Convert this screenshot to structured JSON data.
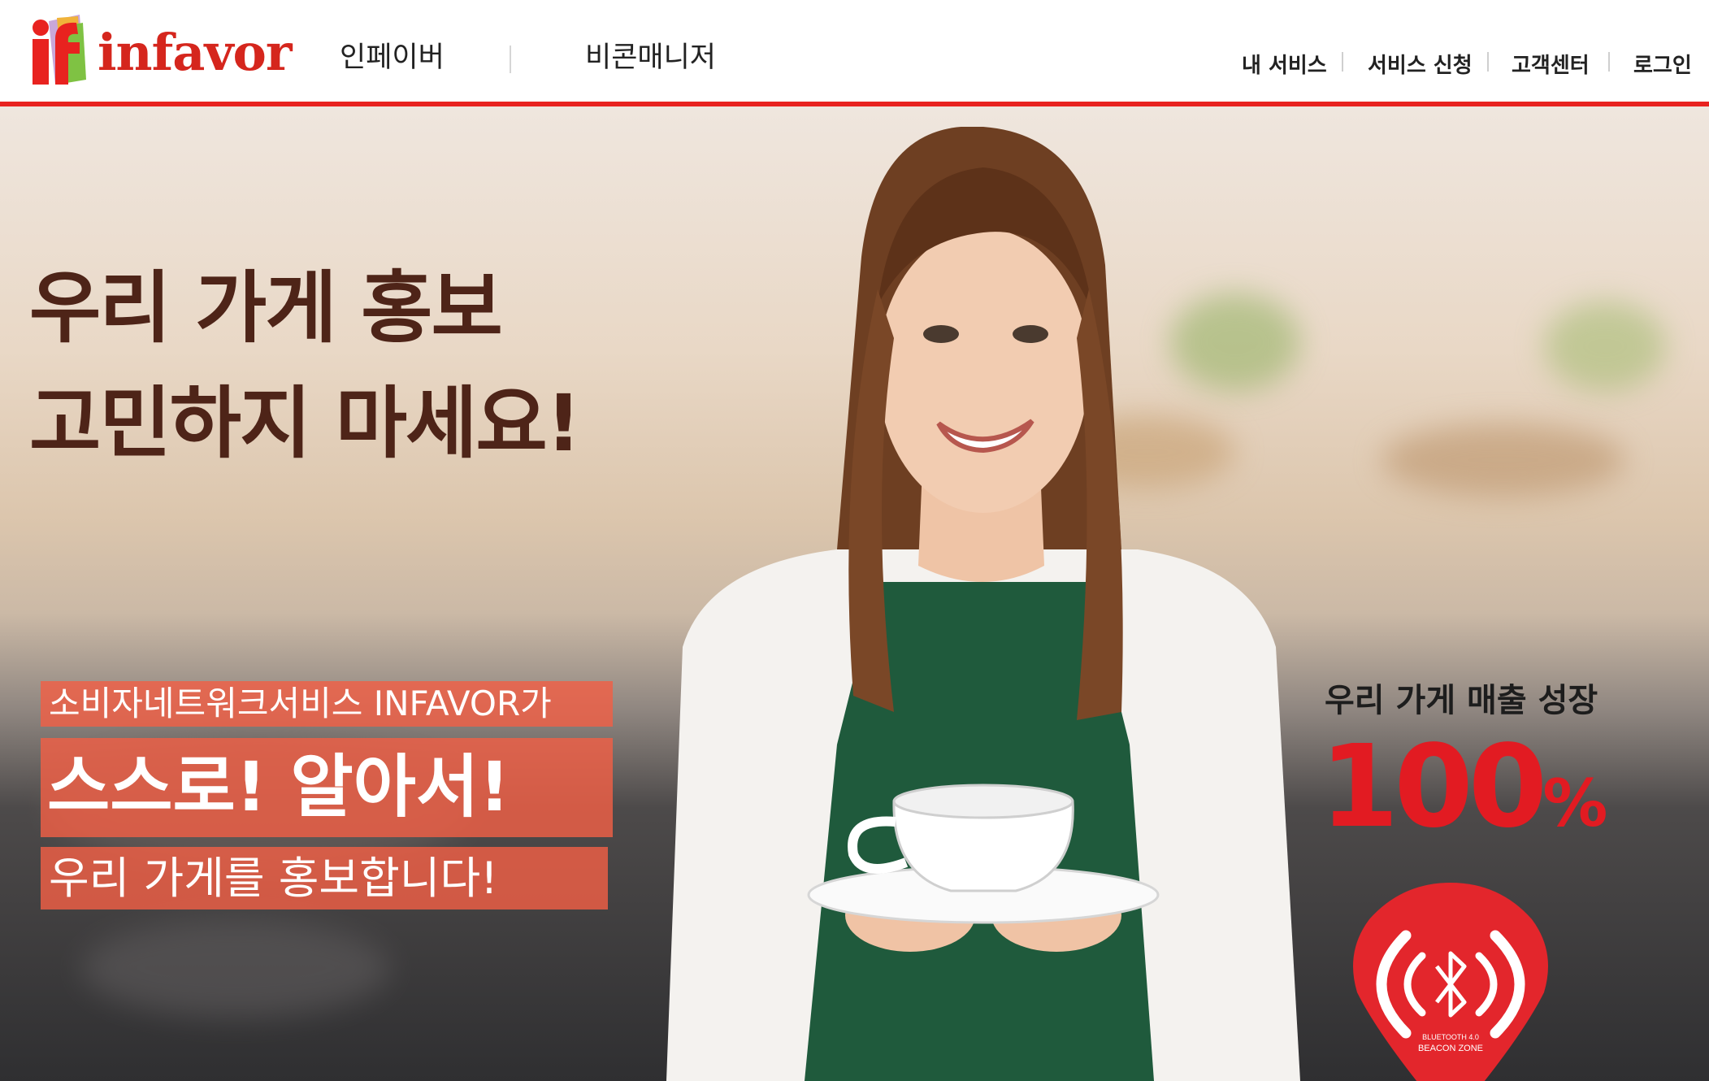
{
  "header": {
    "logo": {
      "mark_text": "if",
      "wordmark": "infavor"
    },
    "main_nav": [
      {
        "label": "인페이버"
      },
      {
        "label": "비콘매니저"
      }
    ],
    "utility_nav": [
      {
        "label": "내 서비스"
      },
      {
        "label": "서비스 신청"
      },
      {
        "label": "고객센터"
      },
      {
        "label": "로그인"
      }
    ]
  },
  "hero": {
    "headline_line1": "우리 가게 홍보",
    "headline_line2": "고민하지 마세요!",
    "promo_line1": "소비자네트워크서비스 INFAVOR가",
    "promo_line2": "스스로! 알아서!",
    "promo_line3": "우리 가게를 홍보합니다!",
    "growth_label": "우리 가게 매출 성장",
    "growth_number": "100",
    "growth_unit": "%",
    "beacon_caption_line1": "BLUETOOTH 4.0",
    "beacon_caption_line2": "BEACON ZONE"
  },
  "colors": {
    "brand_red": "#e8221f",
    "headline_brown": "#4e2418",
    "promo_orange": "#f05f46",
    "growth_red": "#e21b22"
  },
  "icons": {
    "beacon": "bluetooth-beacon-pin-icon"
  }
}
